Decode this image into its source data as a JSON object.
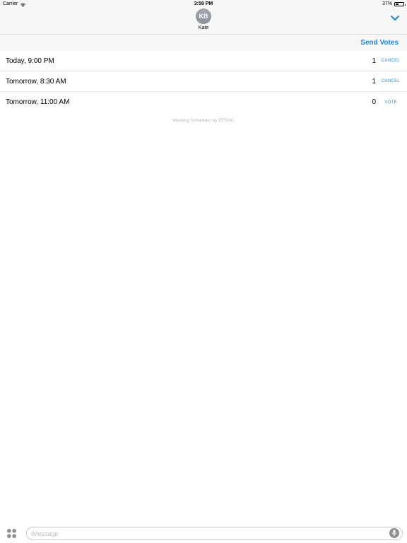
{
  "status_bar": {
    "carrier": "Carrier",
    "time": "3:59 PM",
    "battery_percent": "37%",
    "battery_level": 0.37,
    "wifi_icon": "wifi-icon",
    "battery_icon": "battery-icon"
  },
  "header": {
    "avatar_initials": "KB",
    "contact_name": "Kate",
    "collapse_icon": "chevron-down-icon"
  },
  "toolbar": {
    "send_votes_label": "Send Votes"
  },
  "options": [
    {
      "time": "Today, 9:00 PM",
      "count": "1",
      "action": "CANCEL"
    },
    {
      "time": "Tomorrow, 8:30 AM",
      "count": "1",
      "action": "CANCEL"
    },
    {
      "time": "Tomorrow, 11:00 AM",
      "count": "0",
      "action": "VOTE"
    }
  ],
  "credit": "Meeting Scheduler by EFRAC",
  "input_bar": {
    "placeholder": "iMessage",
    "apps_icon": "app-drawer-icon",
    "mic_icon": "microphone-icon"
  },
  "colors": {
    "accent": "#1f86e8",
    "header_bg": "#f7f7f8",
    "credit_text": "#b9b9b9"
  }
}
